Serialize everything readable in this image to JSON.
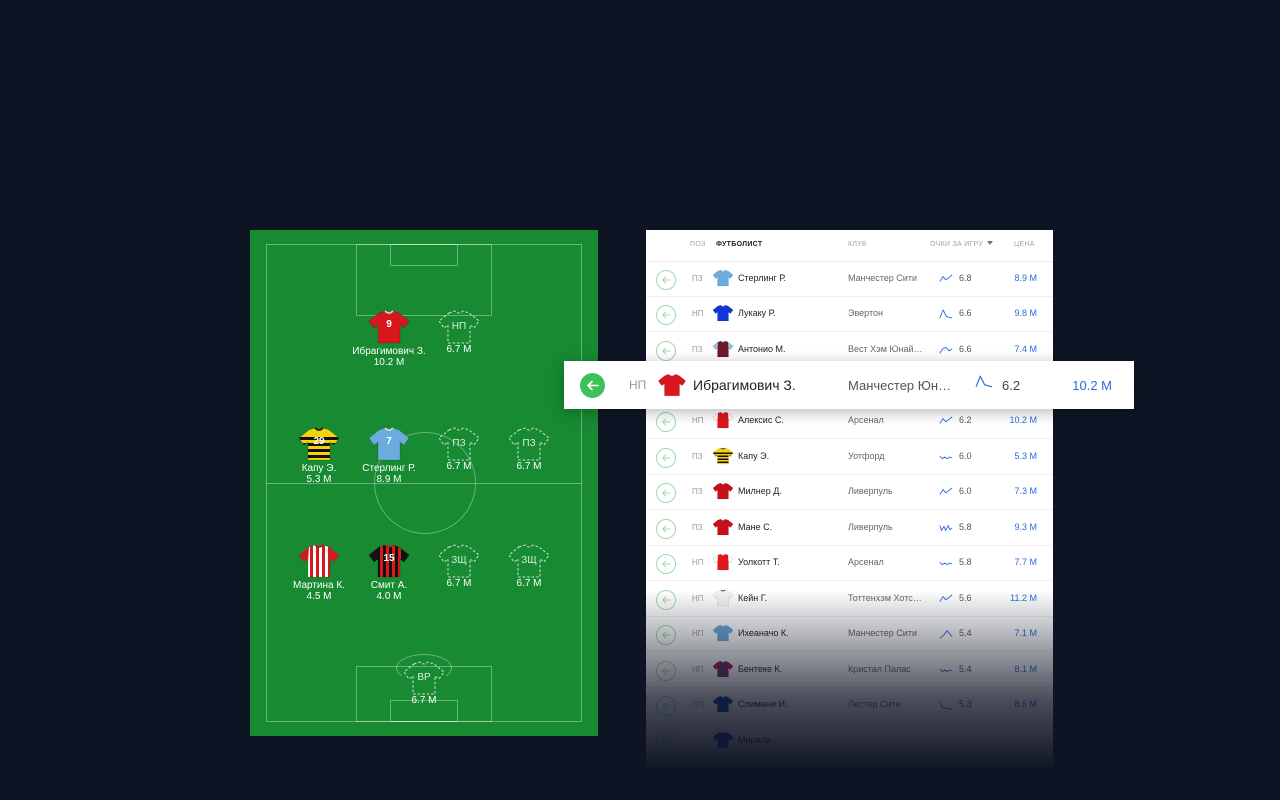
{
  "colors": {
    "background": "#0f1424",
    "pitch": "#178a32",
    "accent_green": "#3dc25a",
    "price_blue": "#2a6be0"
  },
  "pitch": {
    "players": [
      {
        "number": "9",
        "name": "Ибрагимович З.",
        "price": "10.2 M",
        "kit": "manutd"
      },
      {
        "number": "",
        "slot": "НП",
        "name": "",
        "price": "6.7 M",
        "kit": "empty"
      },
      {
        "number": "29",
        "name": "Капу Э.",
        "price": "5.3 M",
        "kit": "watford"
      },
      {
        "number": "7",
        "name": "Стерлинг Р.",
        "price": "8.9 M",
        "kit": "mancity"
      },
      {
        "number": "",
        "slot": "ПЗ",
        "name": "",
        "price": "6.7 M",
        "kit": "empty"
      },
      {
        "number": "",
        "slot": "ПЗ",
        "name": "",
        "price": "6.7 M",
        "kit": "empty"
      },
      {
        "number": "",
        "name": "Мартина К.",
        "price": "4.5 M",
        "kit": "southampton"
      },
      {
        "number": "15",
        "name": "Смит А.",
        "price": "4.0 M",
        "kit": "bournemouth"
      },
      {
        "number": "",
        "slot": "ЗЩ",
        "name": "",
        "price": "6.7 M",
        "kit": "empty"
      },
      {
        "number": "",
        "slot": "ЗЩ",
        "name": "",
        "price": "6.7 M",
        "kit": "empty"
      },
      {
        "number": "",
        "slot": "ВР",
        "name": "",
        "price": "6.7 M",
        "kit": "empty"
      }
    ]
  },
  "table": {
    "headers": {
      "pos": "ПОЗ",
      "player": "ФУТБОЛИСТ",
      "club": "КЛУБ",
      "points": "ОЧКИ ЗА ИГРУ",
      "price": "ЦЕНА"
    },
    "sorted_by": "points",
    "rows": [
      {
        "pos": "ПЗ",
        "name": "Стерлинг Р.",
        "club": "Манчестер Сити",
        "points": "6.8",
        "price": "8.9 M",
        "kit": "mancity",
        "trend": "up"
      },
      {
        "pos": "НП",
        "name": "Лукаку Р.",
        "club": "Эвертон",
        "points": "6.6",
        "price": "9.8 M",
        "kit": "everton",
        "trend": "peak"
      },
      {
        "pos": "ПЗ",
        "name": "Антонио М.",
        "club": "Вест Хэм Юнайтед",
        "points": "6.6",
        "price": "7.4 M",
        "kit": "westham",
        "trend": "hump"
      },
      {
        "pos": "НП",
        "name": "Алексис С.",
        "club": "Арсенал",
        "points": "6.2",
        "price": "10.2 M",
        "kit": "arsenal",
        "trend": "up"
      },
      {
        "pos": "ПЗ",
        "name": "Капу Э.",
        "club": "Уотфорд",
        "points": "6.0",
        "price": "5.3 M",
        "kit": "watford",
        "trend": "wave"
      },
      {
        "pos": "ПЗ",
        "name": "Милнер Д.",
        "club": "Ливерпуль",
        "points": "6.0",
        "price": "7.3 M",
        "kit": "liverpool",
        "trend": "up"
      },
      {
        "pos": "ПЗ",
        "name": "Мане С.",
        "club": "Ливерпуль",
        "points": "5.8",
        "price": "9.3 M",
        "kit": "liverpool",
        "trend": "zigzag"
      },
      {
        "pos": "НП",
        "name": "Уолкотт Т.",
        "club": "Арсенал",
        "points": "5.8",
        "price": "7.7 M",
        "kit": "arsenal",
        "trend": "wave"
      },
      {
        "pos": "НП",
        "name": "Кейн Г.",
        "club": "Тоттенхэм Хотспур",
        "points": "5.6",
        "price": "11.2 M",
        "kit": "spurs",
        "trend": "up"
      },
      {
        "pos": "НП",
        "name": "Ихеаначо К.",
        "club": "Манчестер Сити",
        "points": "5.4",
        "price": "7.1 M",
        "kit": "mancity",
        "trend": "rise"
      },
      {
        "pos": "НП",
        "name": "Бентеке К.",
        "club": "Кристал Палас",
        "points": "5.4",
        "price": "8.1 M",
        "kit": "palace",
        "trend": "wave"
      },
      {
        "pos": "НП",
        "name": "Слимани И.",
        "club": "Лестер Сити",
        "points": "5.3",
        "price": "8.6 M",
        "kit": "leicester",
        "trend": "drop"
      },
      {
        "pos": "",
        "name": "Мирали...",
        "club": "",
        "points": "",
        "price": "",
        "kit": "everton",
        "trend": "up"
      }
    ]
  },
  "highlighted": {
    "pos": "НП",
    "name": "Ибрагимович З.",
    "club": "Манчестер Юнайтед",
    "points": "6.2",
    "price": "10.2 M",
    "kit": "manutd",
    "trend": "peak"
  }
}
